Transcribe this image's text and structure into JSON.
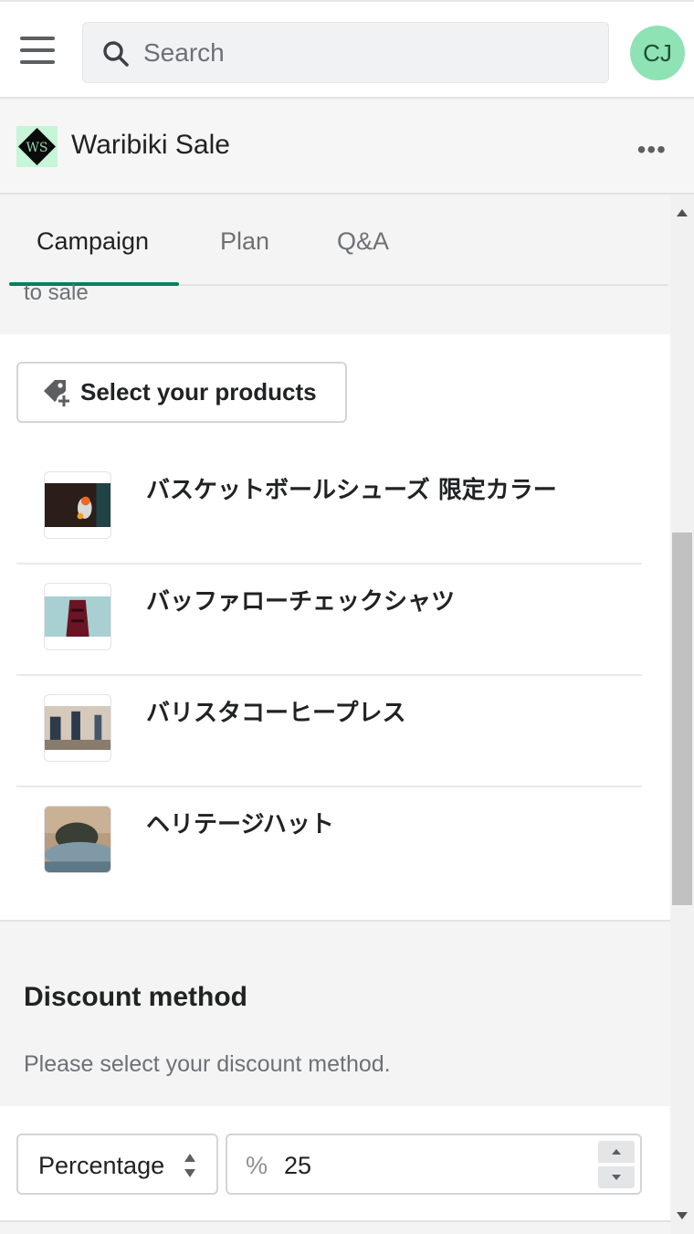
{
  "topbar": {
    "search_placeholder": "Search",
    "avatar_initials": "CJ",
    "avatar_color": "#8ee2b4"
  },
  "app": {
    "title": "Waribiki Sale",
    "logo_text": "WS",
    "more_label": "•••"
  },
  "tabs": [
    {
      "label": "Campaign",
      "active": true
    },
    {
      "label": "Plan",
      "active": false
    },
    {
      "label": "Q&A",
      "active": false
    }
  ],
  "peek": {
    "below_tabs": "to sale"
  },
  "products_card": {
    "select_button_label": "Select your products",
    "items": [
      {
        "name": "バスケットボールシューズ 限定カラー",
        "thumbnail": "basketball-shoes"
      },
      {
        "name": "バッファローチェックシャツ",
        "thumbnail": "buffalo-check-shirt"
      },
      {
        "name": "バリスタコーヒープレス",
        "thumbnail": "coffee-press"
      },
      {
        "name": "ヘリテージハット",
        "thumbnail": "heritage-hat"
      }
    ]
  },
  "discount": {
    "title": "Discount method",
    "subtitle": "Please select your discount method.",
    "method_selected": "Percentage",
    "amount_prefix": "%",
    "amount_value": "25"
  },
  "colors": {
    "accent": "#008060",
    "text": "#202223",
    "subdued": "#6d7175"
  }
}
